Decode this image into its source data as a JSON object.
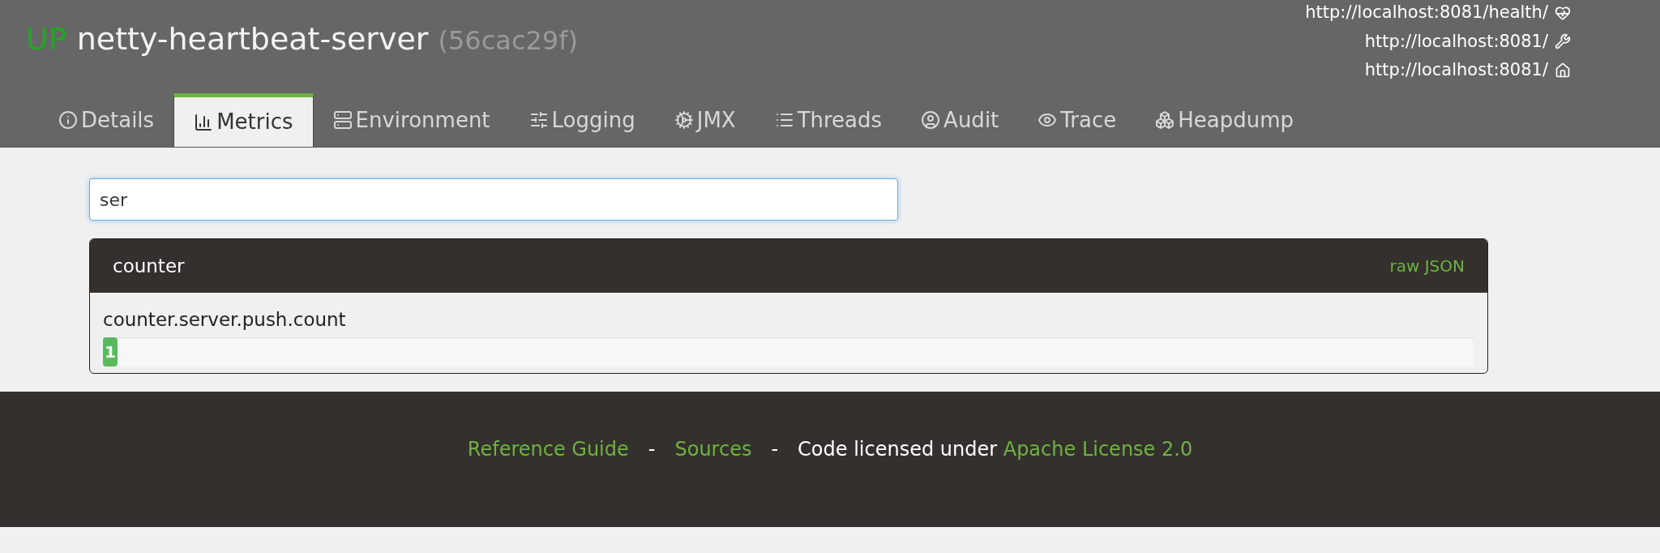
{
  "header": {
    "status": "UP",
    "app_name": "netty-heartbeat-server",
    "app_id": "(56cac29f)",
    "links": [
      {
        "kind": "health",
        "url": "http://localhost:8081/health/"
      },
      {
        "kind": "management",
        "url": "http://localhost:8081/"
      },
      {
        "kind": "service",
        "url": "http://localhost:8081/"
      }
    ]
  },
  "tabs": [
    {
      "kind": "info",
      "label": "Details",
      "selected": false
    },
    {
      "kind": "chart",
      "label": "Metrics",
      "selected": true
    },
    {
      "kind": "server",
      "label": "Environment",
      "selected": false
    },
    {
      "kind": "sliders",
      "label": "Logging",
      "selected": false
    },
    {
      "kind": "cogs",
      "label": "JMX",
      "selected": false
    },
    {
      "kind": "list",
      "label": "Threads",
      "selected": false
    },
    {
      "kind": "user",
      "label": "Audit",
      "selected": false
    },
    {
      "kind": "eye",
      "label": "Trace",
      "selected": false
    },
    {
      "kind": "cubes",
      "label": "Heapdump",
      "selected": false
    }
  ],
  "filter": {
    "value": "ser"
  },
  "panel": {
    "title": "counter",
    "action": "raw JSON",
    "metrics": [
      {
        "name": "counter.server.push.count",
        "value": "1",
        "level": 0.01
      }
    ]
  },
  "footer": {
    "links": [
      "Reference Guide",
      "Sources"
    ],
    "separators": [
      "-",
      "-"
    ],
    "license_text": "Code licensed under",
    "license_link": "Apache License 2.0"
  }
}
